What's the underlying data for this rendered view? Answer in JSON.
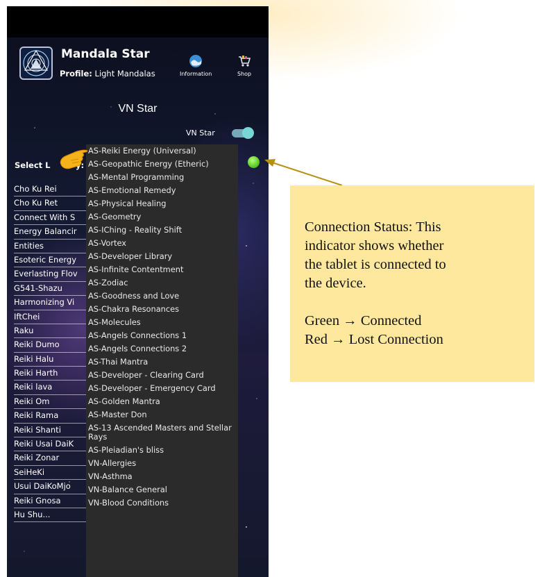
{
  "app": {
    "title": "Mandala Star",
    "profile_label": "Profile:",
    "profile_value": "Light Mandalas",
    "information_label": "Information",
    "shop_label": "Shop"
  },
  "screen": {
    "title": "VN Star",
    "toggle_label": "VN Star",
    "toggle_on": true,
    "select_label": "Select L",
    "select_label_tail": "y:",
    "connection_status_color": "#4cc31c"
  },
  "left_list": [
    "Cho Ku Rei",
    "Cho Ku Ret",
    "Connect With S",
    "Energy Balancir",
    "Entities",
    "Esoteric Energy",
    "Everlasting Flov",
    "G541-Shazu",
    "Harmonizing Vi",
    "IftChei",
    "Raku",
    "Reiki Dumo",
    "Reiki Halu",
    "Reiki Harth",
    "Reiki lava",
    "Reiki Om",
    "Reiki Rama",
    "Reiki Shanti",
    "Reiki Usai DaiK",
    "Reiki Zonar",
    "SeiHeKi",
    "Usui DaiKoMjo",
    "Reiki Gnosa",
    "Hu Shu..."
  ],
  "dropdown_items": [
    "AS-Reiki Energy (Universal)",
    "AS-Geopathic Energy (Etheric)",
    "AS-Mental Programming",
    "AS-Emotional Remedy",
    "AS-Physical Healing",
    "AS-Geometry",
    "AS-IChing - Reality Shift",
    "AS-Vortex",
    "AS-Developer Library",
    "AS-Infinite Contentment",
    "AS-Zodiac",
    "AS-Goodness and Love",
    "AS-Chakra Resonances",
    "AS-Molecules",
    "AS-Angels Connections 1",
    "AS-Angels Connections 2",
    "AS-Thai Mantra",
    "AS-Developer - Clearing Card",
    "AS-Developer - Emergency Card",
    "AS-Golden Mantra",
    "AS-Master Don",
    "AS-13 Ascended Masters and Stellar Rays",
    "AS-Pleiadian's bliss",
    "VN-Allergies",
    "VN-Asthma",
    "VN-Balance General",
    "VN-Blood Conditions"
  ],
  "annotation": {
    "line1": "Connection Status: This",
    "line2": "indicator shows whether",
    "line3": "the tablet is connected to",
    "line4": "the device.",
    "green_line": "Green → Connected",
    "red_line": "Red → Lost Connection",
    "arrow_color": "#b8900f"
  },
  "icons": {
    "logo": "mandala-logo-icon",
    "information": "information-globe-icon",
    "shop": "shopping-cart-icon",
    "pointer": "pointing-hand-icon"
  }
}
